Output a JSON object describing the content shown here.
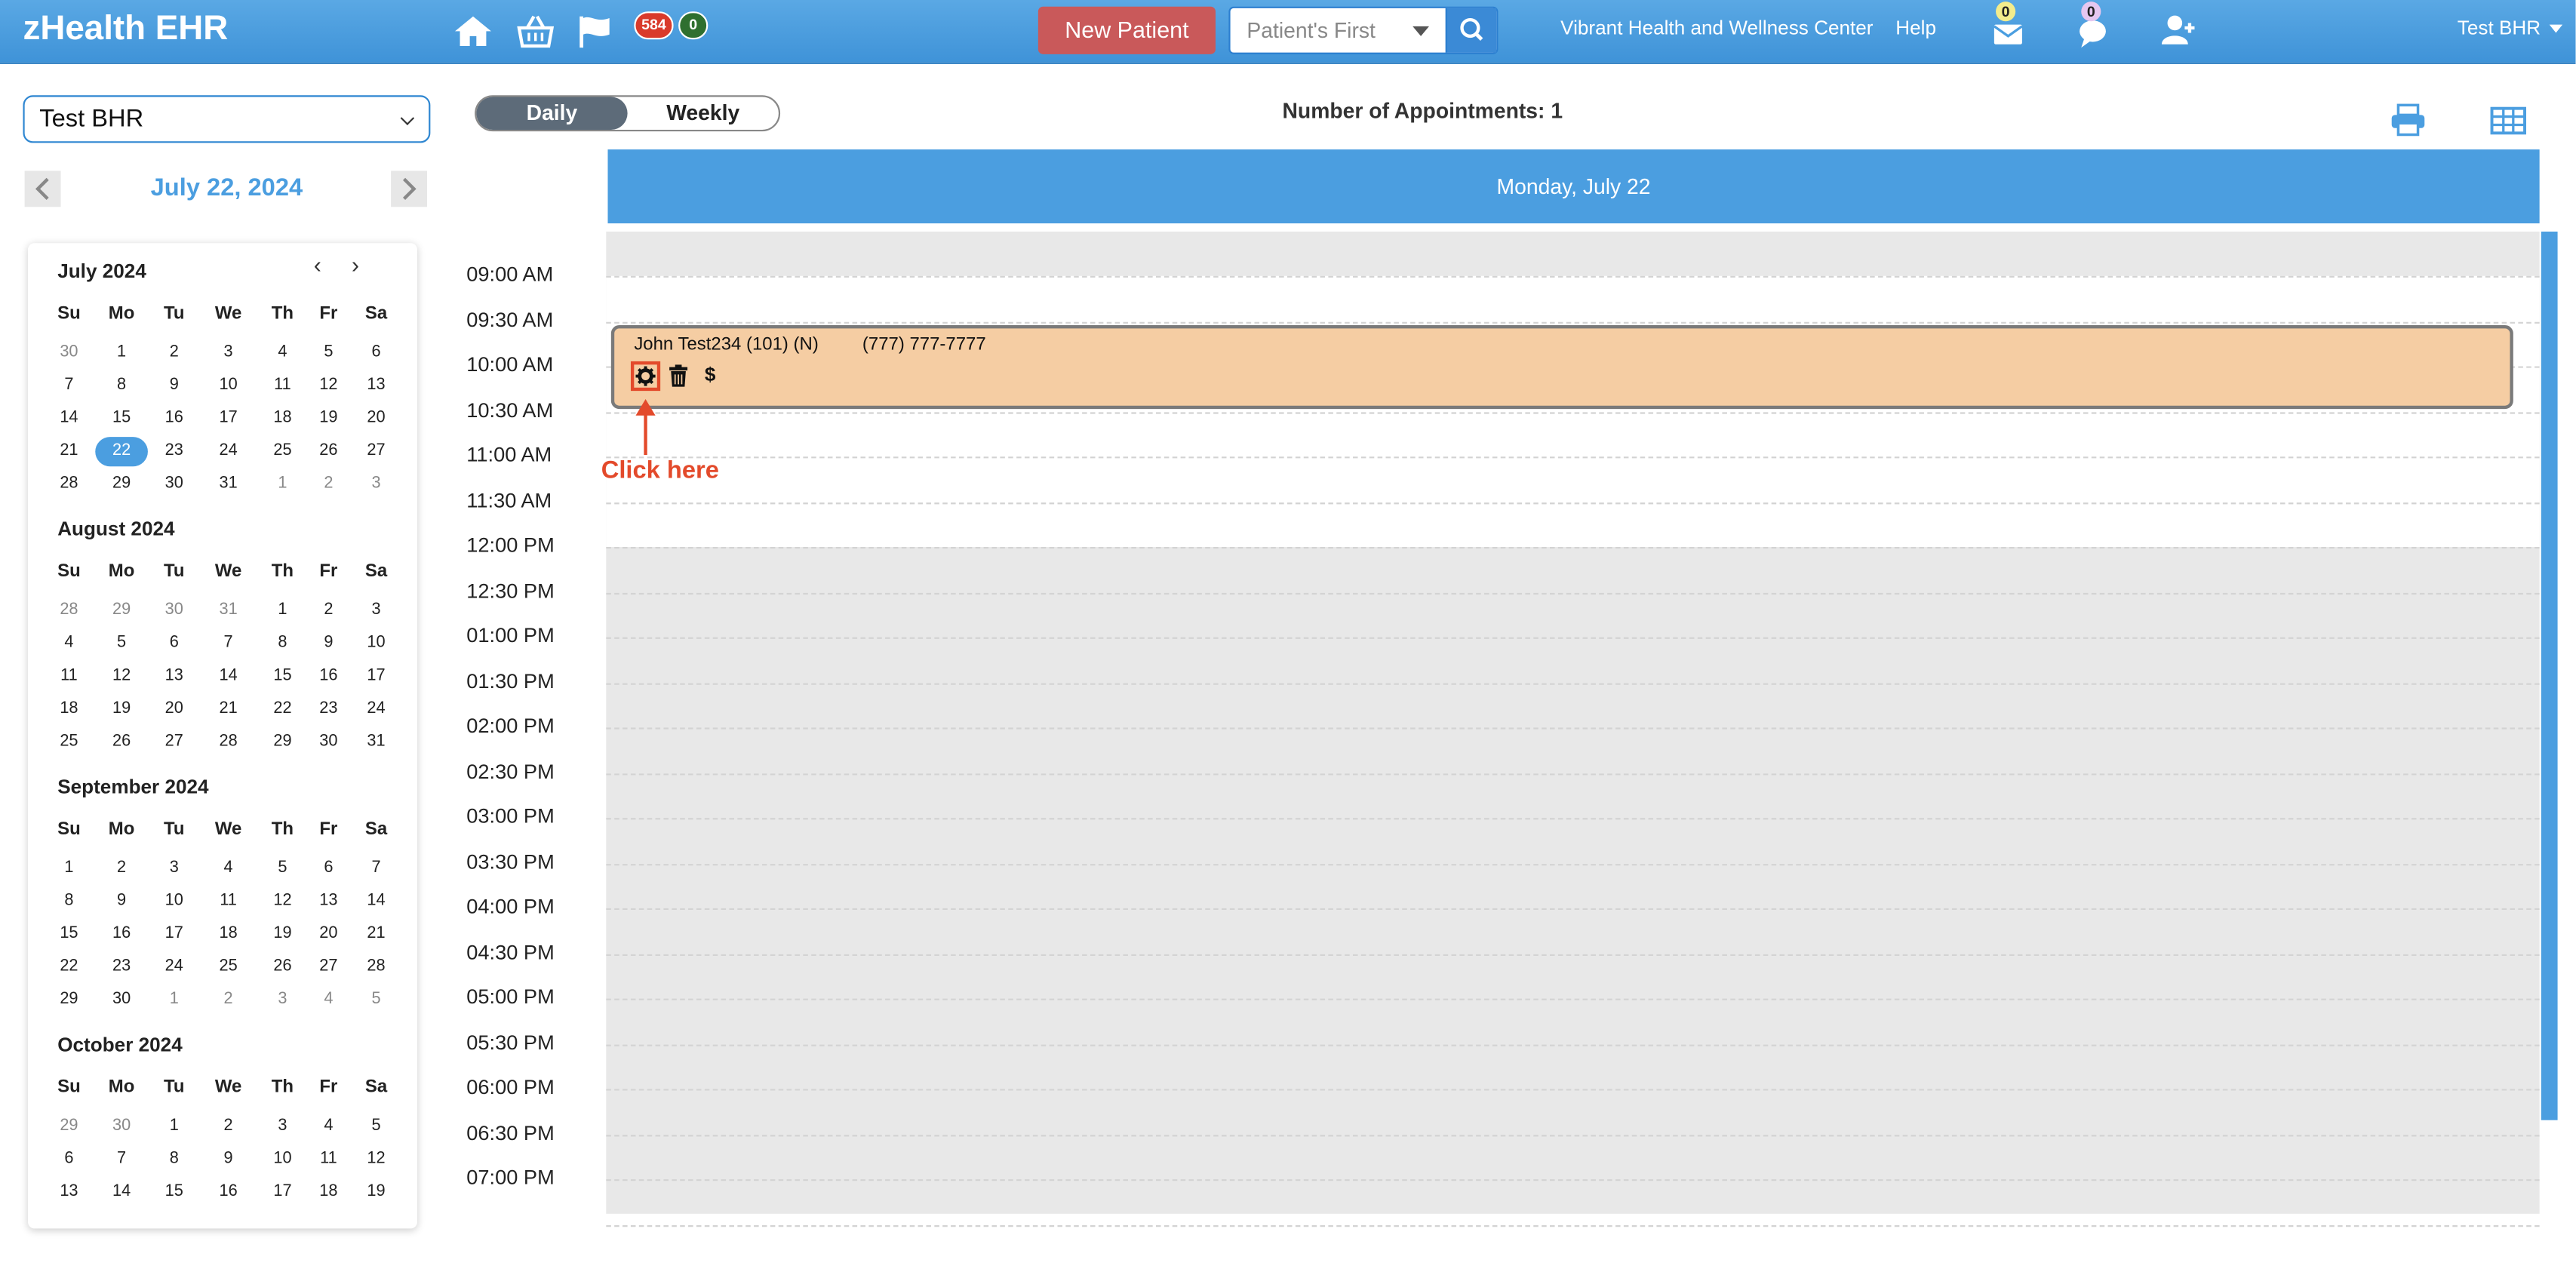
{
  "app": {
    "brand": "zHealth EHR"
  },
  "header": {
    "badge_red": "584",
    "badge_green": "0",
    "new_patient_label": "New Patient",
    "search_placeholder": "Patient's First",
    "clinic_name": "Vibrant Health and Wellness Center",
    "help_label": "Help",
    "mail_count": "0",
    "chat_count": "0",
    "user_name": "Test BHR"
  },
  "sidebar": {
    "provider": "Test BHR",
    "current_date": "July 22, 2024",
    "dow": [
      "Su",
      "Mo",
      "Tu",
      "We",
      "Th",
      "Fr",
      "Sa"
    ],
    "months": [
      {
        "title": "July 2024",
        "selected": "22",
        "rows": [
          [
            [
              "30",
              1
            ],
            [
              "1",
              0
            ],
            [
              "2",
              0
            ],
            [
              "3",
              0
            ],
            [
              "4",
              0
            ],
            [
              "5",
              0
            ],
            [
              "6",
              0
            ]
          ],
          [
            [
              "7",
              0
            ],
            [
              "8",
              0
            ],
            [
              "9",
              0
            ],
            [
              "10",
              0
            ],
            [
              "11",
              0
            ],
            [
              "12",
              0
            ],
            [
              "13",
              0
            ]
          ],
          [
            [
              "14",
              0
            ],
            [
              "15",
              0
            ],
            [
              "16",
              0
            ],
            [
              "17",
              0
            ],
            [
              "18",
              0
            ],
            [
              "19",
              0
            ],
            [
              "20",
              0
            ]
          ],
          [
            [
              "21",
              0
            ],
            [
              "22",
              0
            ],
            [
              "23",
              0
            ],
            [
              "24",
              0
            ],
            [
              "25",
              0
            ],
            [
              "26",
              0
            ],
            [
              "27",
              0
            ]
          ],
          [
            [
              "28",
              0
            ],
            [
              "29",
              0
            ],
            [
              "30",
              0
            ],
            [
              "31",
              0
            ],
            [
              "1",
              1
            ],
            [
              "2",
              1
            ],
            [
              "3",
              1
            ]
          ]
        ]
      },
      {
        "title": "August 2024",
        "selected": "",
        "rows": [
          [
            [
              "28",
              1
            ],
            [
              "29",
              1
            ],
            [
              "30",
              1
            ],
            [
              "31",
              1
            ],
            [
              "1",
              0
            ],
            [
              "2",
              0
            ],
            [
              "3",
              0
            ]
          ],
          [
            [
              "4",
              0
            ],
            [
              "5",
              0
            ],
            [
              "6",
              0
            ],
            [
              "7",
              0
            ],
            [
              "8",
              0
            ],
            [
              "9",
              0
            ],
            [
              "10",
              0
            ]
          ],
          [
            [
              "11",
              0
            ],
            [
              "12",
              0
            ],
            [
              "13",
              0
            ],
            [
              "14",
              0
            ],
            [
              "15",
              0
            ],
            [
              "16",
              0
            ],
            [
              "17",
              0
            ]
          ],
          [
            [
              "18",
              0
            ],
            [
              "19",
              0
            ],
            [
              "20",
              0
            ],
            [
              "21",
              0
            ],
            [
              "22",
              0
            ],
            [
              "23",
              0
            ],
            [
              "24",
              0
            ]
          ],
          [
            [
              "25",
              0
            ],
            [
              "26",
              0
            ],
            [
              "27",
              0
            ],
            [
              "28",
              0
            ],
            [
              "29",
              0
            ],
            [
              "30",
              0
            ],
            [
              "31",
              0
            ]
          ]
        ]
      },
      {
        "title": "September 2024",
        "selected": "",
        "rows": [
          [
            [
              "1",
              0
            ],
            [
              "2",
              0
            ],
            [
              "3",
              0
            ],
            [
              "4",
              0
            ],
            [
              "5",
              0
            ],
            [
              "6",
              0
            ],
            [
              "7",
              0
            ]
          ],
          [
            [
              "8",
              0
            ],
            [
              "9",
              0
            ],
            [
              "10",
              0
            ],
            [
              "11",
              0
            ],
            [
              "12",
              0
            ],
            [
              "13",
              0
            ],
            [
              "14",
              0
            ]
          ],
          [
            [
              "15",
              0
            ],
            [
              "16",
              0
            ],
            [
              "17",
              0
            ],
            [
              "18",
              0
            ],
            [
              "19",
              0
            ],
            [
              "20",
              0
            ],
            [
              "21",
              0
            ]
          ],
          [
            [
              "22",
              0
            ],
            [
              "23",
              0
            ],
            [
              "24",
              0
            ],
            [
              "25",
              0
            ],
            [
              "26",
              0
            ],
            [
              "27",
              0
            ],
            [
              "28",
              0
            ]
          ],
          [
            [
              "29",
              0
            ],
            [
              "30",
              0
            ],
            [
              "1",
              1
            ],
            [
              "2",
              1
            ],
            [
              "3",
              1
            ],
            [
              "4",
              1
            ],
            [
              "5",
              1
            ]
          ]
        ]
      },
      {
        "title": "October 2024",
        "selected": "",
        "rows": [
          [
            [
              "29",
              1
            ],
            [
              "30",
              1
            ],
            [
              "1",
              0
            ],
            [
              "2",
              0
            ],
            [
              "3",
              0
            ],
            [
              "4",
              0
            ],
            [
              "5",
              0
            ]
          ],
          [
            [
              "6",
              0
            ],
            [
              "7",
              0
            ],
            [
              "8",
              0
            ],
            [
              "9",
              0
            ],
            [
              "10",
              0
            ],
            [
              "11",
              0
            ],
            [
              "12",
              0
            ]
          ],
          [
            [
              "13",
              0
            ],
            [
              "14",
              0
            ],
            [
              "15",
              0
            ],
            [
              "16",
              0
            ],
            [
              "17",
              0
            ],
            [
              "18",
              0
            ],
            [
              "19",
              0
            ]
          ]
        ]
      }
    ]
  },
  "toolbar": {
    "daily_label": "Daily",
    "weekly_label": "Weekly",
    "appointments_count": "Number of Appointments: 1"
  },
  "schedule": {
    "day_header": "Monday, July 22",
    "times": [
      "09:00 AM",
      "09:30 AM",
      "10:00 AM",
      "10:30 AM",
      "11:00 AM",
      "11:30 AM",
      "12:00 PM",
      "12:30 PM",
      "01:00 PM",
      "01:30 PM",
      "02:00 PM",
      "02:30 PM",
      "03:00 PM",
      "03:30 PM",
      "04:00 PM",
      "04:30 PM",
      "05:00 PM",
      "05:30 PM",
      "06:00 PM",
      "06:30 PM",
      "07:00 PM"
    ],
    "appointment": {
      "patient": "John Test234 (101) (N)",
      "phone": "(777) 777-7777",
      "billing_symbol": "$"
    },
    "annotation": "Click here"
  },
  "colors": {
    "accent": "#4b9ee0",
    "appointment": "#f5cda3",
    "new_patient": "#c9595a",
    "annotation": "#e34a2b"
  }
}
